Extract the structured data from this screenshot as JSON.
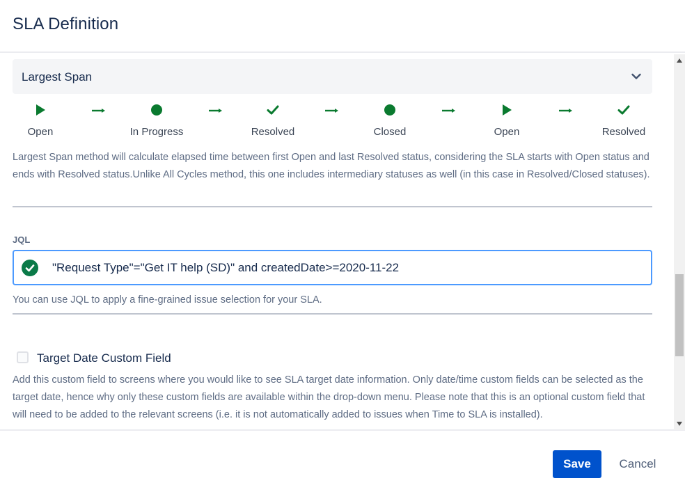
{
  "dialog": {
    "title": "SLA Definition"
  },
  "span_method": {
    "selected": "Largest Span"
  },
  "flow": {
    "steps": [
      {
        "label": "Open",
        "icon": "play-icon"
      },
      {
        "label": "In Progress",
        "icon": "circle-icon"
      },
      {
        "label": "Resolved",
        "icon": "check-icon"
      },
      {
        "label": "Closed",
        "icon": "circle-icon"
      },
      {
        "label": "Open",
        "icon": "play-icon"
      },
      {
        "label": "Resolved",
        "icon": "check-icon"
      }
    ],
    "icon_color": "#0a7a2f"
  },
  "span_description": "Largest Span method will calculate elapsed time between first Open and last Resolved status, considering the SLA starts with Open status and ends with Resolved status.Unlike All Cycles method, this one includes intermediary statuses as well (in this case in Resolved/Closed statuses).",
  "jql": {
    "label": "JQL",
    "value": "\"Request Type\"=\"Get IT help (SD)\" and createdDate>=2020-11-22",
    "help": "You can use JQL to apply a fine-grained issue selection for your SLA."
  },
  "target_date": {
    "label": "Target Date Custom Field",
    "checked": false,
    "description": "Add this custom field to screens where you would like to see SLA target date information. Only date/time custom fields can be selected as the target date, hence why only these custom fields are available within the drop-down menu. Please note that this is an optional custom field that will need to be added to the relevant screens (i.e. it is not automatically added to issues when Time to SLA is installed)."
  },
  "footer": {
    "save_label": "Save",
    "cancel_label": "Cancel"
  },
  "colors": {
    "primary": "#0052cc",
    "focus": "#4c9aff",
    "success": "#0a7a2f"
  }
}
